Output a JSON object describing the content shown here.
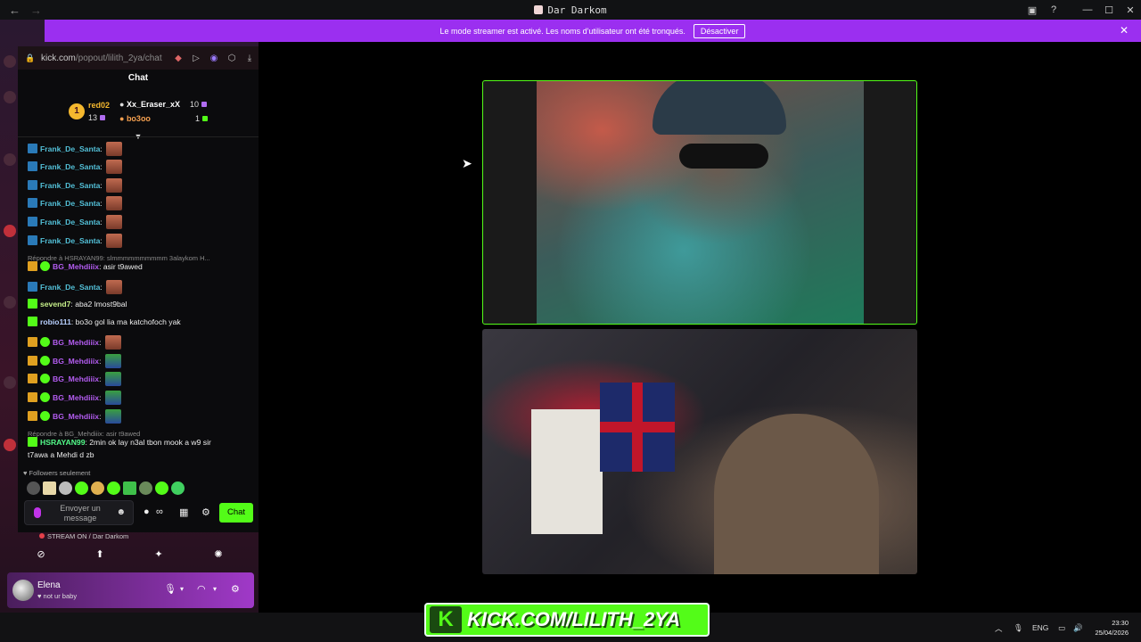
{
  "window": {
    "title": "Dar Darkom",
    "back_icon": "arrow-left",
    "forward_icon": "arrow-right"
  },
  "banner": {
    "text": "Le mode streamer est activé. Les noms d'utilisateur ont été tronqués.",
    "button": "Désactiver",
    "color": "#9b2ff0"
  },
  "browser": {
    "url_host": "kick.com",
    "url_path": "/popout/lilith_2ya/chat"
  },
  "chat": {
    "title": "Chat",
    "leaderboard": {
      "first": {
        "rank": "1",
        "name": "red02",
        "count": "13"
      },
      "second": {
        "name": "Xx_Eraser_xX",
        "count": "10"
      },
      "third": {
        "name": "bo3oo",
        "count": "1"
      }
    },
    "messages": [
      {
        "user": "Frank_De_Santa",
        "text": "",
        "color": "#53c0d8"
      },
      {
        "user": "Frank_De_Santa",
        "text": "",
        "color": "#53c0d8"
      },
      {
        "user": "Frank_De_Santa",
        "text": "",
        "color": "#53c0d8"
      },
      {
        "user": "Frank_De_Santa",
        "text": "",
        "color": "#53c0d8"
      },
      {
        "user": "Frank_De_Santa",
        "text": "",
        "color": "#53c0d8"
      },
      {
        "user": "Frank_De_Santa",
        "text": "",
        "color": "#53c0d8"
      },
      {
        "reply": "Répondre à HSRAYAN99: slmmmmmmmmmm 3alaykom H...",
        "user": "BG_Mehdiiix",
        "text": "asir t9awed",
        "color": "#b35cf0"
      },
      {
        "user": "Frank_De_Santa",
        "text": "",
        "color": "#53c0d8"
      },
      {
        "user": "sevend7",
        "text": "aba2 lmost9bal",
        "color": "#c7f08a"
      },
      {
        "user": "robio111",
        "text": "bo3o gol lia ma katchofoch yak",
        "color": "#b8d0ff"
      },
      {
        "user": "BG_Mehdiiix",
        "text": "",
        "color": "#b35cf0"
      },
      {
        "user": "BG_Mehdiiix",
        "text": "",
        "color": "#b35cf0"
      },
      {
        "user": "BG_Mehdiiix",
        "text": "",
        "color": "#b35cf0"
      },
      {
        "user": "BG_Mehdiiix",
        "text": "",
        "color": "#b35cf0"
      },
      {
        "user": "BG_Mehdiiix",
        "text": "",
        "color": "#b35cf0"
      },
      {
        "reply": "Répondre à BG_Mehdiiix: asir t9awed",
        "user": "HSRAYAN99",
        "text": "2min ok lay n3al tbon mook a w9 sir",
        "text2": "t7awa a Mehdi d zb",
        "color": "#53fc8a"
      }
    ],
    "followers_only": "Followers seulement",
    "input_placeholder": "Envoyer un message",
    "send_button": "Chat"
  },
  "discord": {
    "stream_status": "STREAM ON / Dar Darkom",
    "user_name": "Elena",
    "user_status": "not ur baby"
  },
  "taskbar": {
    "language": "ENG",
    "time": "23:30",
    "date": "25/04/2026"
  },
  "watermark": {
    "letter": "K",
    "text": "KICK.COM/LILITH_2YA"
  },
  "colors": {
    "kick_green": "#53fc18",
    "brand_purple": "#9b2ff0"
  }
}
